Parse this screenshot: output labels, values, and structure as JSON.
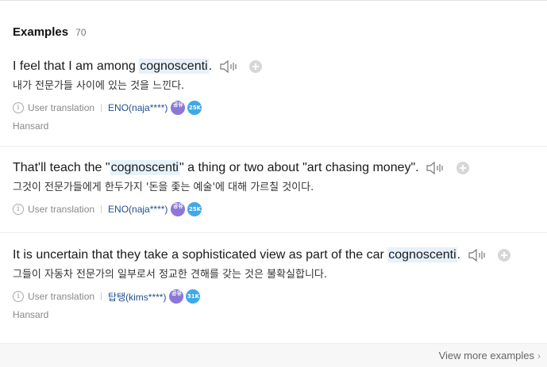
{
  "section": {
    "title": "Examples",
    "count": "70"
  },
  "examples": [
    {
      "sentence_before": "I feel that I am among ",
      "highlight": "cognoscenti",
      "sentence_after": ".",
      "translation": "내가 전문가들 사이에 있는 것을 느낀다.",
      "meta_label": "User translation",
      "user": "ENO(naja****)",
      "level_badge": "공유",
      "count_badge": "25K",
      "source": "Hansard"
    },
    {
      "sentence_before": "That'll teach the \"",
      "highlight": "cognoscenti",
      "sentence_after": "\" a thing or two about \"art chasing money\".",
      "translation": "그것이 전문가들에게 한두가지 '돈을 좇는 예술'에 대해 가르칠 것이다.",
      "meta_label": "User translation",
      "user": "ENO(naja****)",
      "level_badge": "공유",
      "count_badge": "25K",
      "source": ""
    },
    {
      "sentence_before": "It is uncertain that they take a sophisticated view as part of the car ",
      "highlight": "cognoscenti",
      "sentence_after": ".",
      "translation": "그들이 자동차 전문가의 일부로서 정교한 견해를 갖는 것은 불확실합니다.",
      "meta_label": "User translation",
      "user": "탑탱(kims****)",
      "level_badge": "공유",
      "count_badge": "31K",
      "source": "Hansard"
    }
  ],
  "footer": {
    "view_more": "View more examples"
  },
  "colors": {
    "highlight_bg": "#e6f1fc",
    "user_link": "#1f4f91",
    "level_badge": "#8b78d6",
    "count_badge": "#3fa9e8"
  },
  "icons": [
    "speaker-icon",
    "add-icon",
    "info-icon",
    "chevron-right-icon"
  ]
}
